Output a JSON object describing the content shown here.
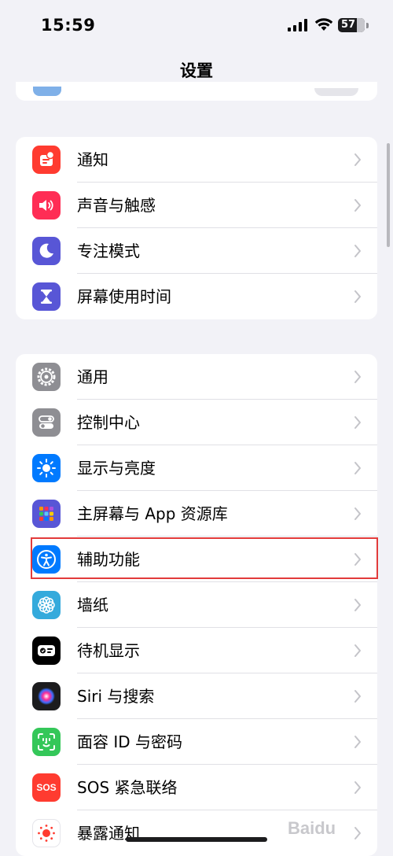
{
  "status_bar": {
    "time": "15:59",
    "battery": "57"
  },
  "nav": {
    "title": "设置"
  },
  "groups": [
    {
      "rows": [
        {
          "label": "通知",
          "icon": "notifications-icon",
          "color": "#ff3b30"
        },
        {
          "label": "声音与触感",
          "icon": "speaker-icon",
          "color": "#ff2d55"
        },
        {
          "label": "专注模式",
          "icon": "moon-icon",
          "color": "#5856d6"
        },
        {
          "label": "屏幕使用时间",
          "icon": "hourglass-icon",
          "color": "#5856d6"
        }
      ]
    },
    {
      "rows": [
        {
          "label": "通用",
          "icon": "gear-icon",
          "color": "#8e8e93"
        },
        {
          "label": "控制中心",
          "icon": "toggles-icon",
          "color": "#8e8e93"
        },
        {
          "label": "显示与亮度",
          "icon": "sun-icon",
          "color": "#007aff"
        },
        {
          "label": "主屏幕与 App 资源库",
          "icon": "app-grid-icon",
          "color": "#5856d6"
        },
        {
          "label": "辅助功能",
          "icon": "accessibility-icon",
          "color": "#007aff"
        },
        {
          "label": "墙纸",
          "icon": "flower-icon",
          "color": "#34aadc"
        },
        {
          "label": "待机显示",
          "icon": "standby-icon",
          "color": "#000000"
        },
        {
          "label": "Siri 与搜索",
          "icon": "siri-icon",
          "color": "#1c1c1e"
        },
        {
          "label": "面容 ID 与密码",
          "icon": "face-id-icon",
          "color": "#34c759"
        },
        {
          "label": "SOS 紧急联络",
          "icon": "sos-icon",
          "color": "#ff3b30",
          "icon_text": "SOS"
        },
        {
          "label": "暴露通知",
          "icon": "exposure-icon",
          "color": "#ffffff"
        }
      ]
    }
  ],
  "watermark": "Baidu"
}
